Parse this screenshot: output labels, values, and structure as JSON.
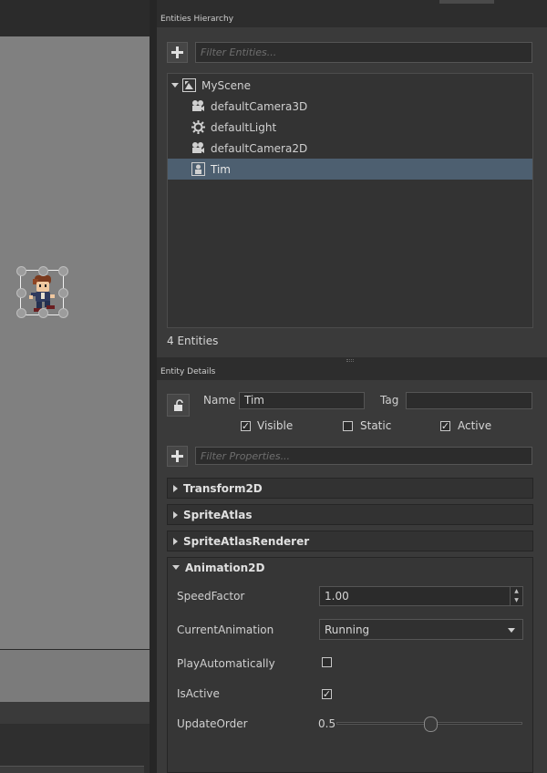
{
  "hierarchy": {
    "title": "Entities Hierarchy",
    "filter_placeholder": "Filter Entities...",
    "items": [
      {
        "label": "MyScene",
        "icon": "scene-icon"
      },
      {
        "label": "defaultCamera3D",
        "icon": "camera-icon"
      },
      {
        "label": "defaultLight",
        "icon": "light-icon"
      },
      {
        "label": "defaultCamera2D",
        "icon": "camera-icon"
      },
      {
        "label": "Tim",
        "icon": "sprite-entity-icon",
        "selected": true
      }
    ],
    "count_label": "4 Entities"
  },
  "details": {
    "title": "Entity Details",
    "name_label": "Name",
    "name_value": "Tim",
    "tag_label": "Tag",
    "tag_value": "",
    "visible_label": "Visible",
    "visible_checked": true,
    "static_label": "Static",
    "static_checked": false,
    "active_label": "Active",
    "active_checked": true,
    "filter_placeholder": "Filter Properties...",
    "components": [
      {
        "label": "Transform2D",
        "expanded": false
      },
      {
        "label": "SpriteAtlas",
        "expanded": false
      },
      {
        "label": "SpriteAtlasRenderer",
        "expanded": false
      },
      {
        "label": "Animation2D",
        "expanded": true
      }
    ],
    "animation": {
      "speed_label": "SpeedFactor",
      "speed_value": "1.00",
      "current_label": "CurrentAnimation",
      "current_value": "Running",
      "play_label": "PlayAutomatically",
      "play_checked": false,
      "isactive_label": "IsActive",
      "isactive_checked": true,
      "update_label": "UpdateOrder",
      "update_value": "0.5",
      "update_fraction": 0.5
    }
  },
  "colors": {
    "selection": "#4d5f70",
    "viewport": "#808080",
    "panel": "#3a3a3a"
  }
}
